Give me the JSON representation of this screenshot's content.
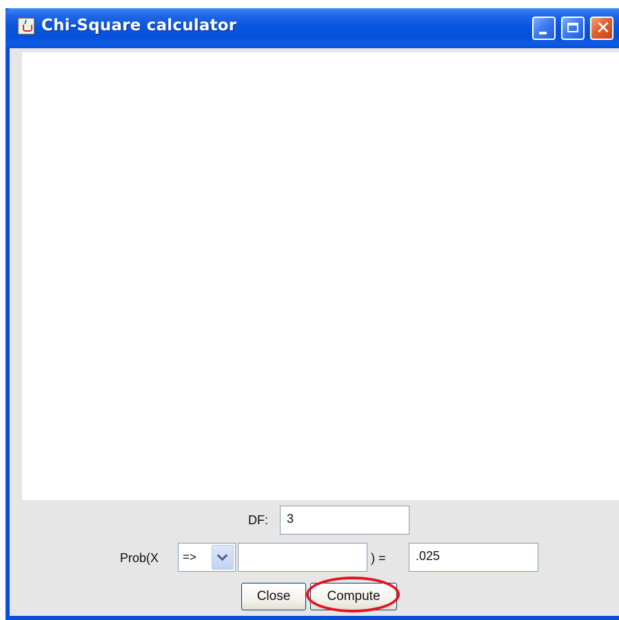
{
  "window": {
    "title": "Chi-Square calculator",
    "icon": "java-cup-icon",
    "controls": [
      "minimize-icon",
      "maximize-icon",
      "close-icon"
    ],
    "accent_color": "#0a4fd8"
  },
  "form": {
    "df_label": "DF:",
    "df_value": "3",
    "prob_label": "Prob(X",
    "operator_selected": "=>",
    "x_value": "",
    "equals_label": ") =",
    "prob_value": ".025"
  },
  "buttons": {
    "close_label": "Close",
    "compute_label": "Compute"
  },
  "annotation": {
    "highlight_color": "#e8121b"
  }
}
